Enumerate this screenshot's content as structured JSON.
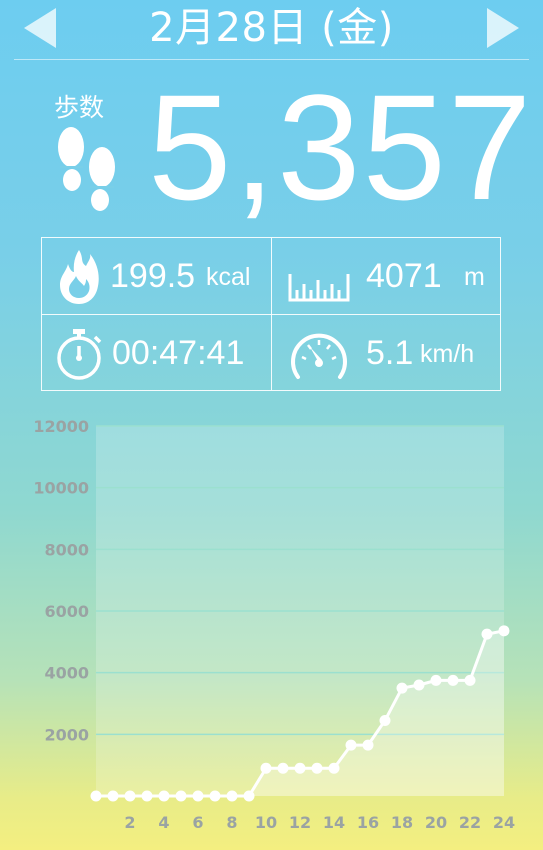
{
  "header": {
    "date": "2月28日 (金)",
    "prev_icon": "left-triangle-arrow",
    "next_icon": "right-triangle-arrow"
  },
  "steps": {
    "label": "歩数",
    "value": "5,357",
    "icon": "footprints-icon"
  },
  "stats": {
    "calories": {
      "value": "199.5",
      "unit": "kcal",
      "icon": "flame-icon"
    },
    "distance": {
      "value": "4071",
      "unit": "m",
      "icon": "ruler-icon"
    },
    "time": {
      "value": "00:47:41",
      "icon": "stopwatch-icon"
    },
    "speed": {
      "value": "5.1",
      "unit": "km/h",
      "icon": "speedometer-icon"
    }
  },
  "chart_data": {
    "type": "line",
    "title": "",
    "xlabel": "",
    "ylabel": "",
    "x": [
      0,
      1,
      2,
      3,
      4,
      5,
      6,
      7,
      8,
      9,
      10,
      11,
      12,
      13,
      14,
      15,
      16,
      17,
      18,
      19,
      20,
      21,
      22,
      23,
      24
    ],
    "x_tick_labels": [
      "2",
      "4",
      "6",
      "8",
      "10",
      "12",
      "14",
      "16",
      "18",
      "20",
      "22",
      "24"
    ],
    "y_tick_labels": [
      "2000",
      "4000",
      "6000",
      "8000",
      "10000",
      "12000"
    ],
    "ylim": [
      0,
      12000
    ],
    "xlim": [
      0,
      24
    ],
    "grid": true,
    "series": [
      {
        "values": [
          0,
          0,
          0,
          0,
          0,
          0,
          0,
          0,
          0,
          0,
          900,
          900,
          900,
          900,
          900,
          1650,
          1650,
          2450,
          3500,
          3600,
          3750,
          3750,
          3750,
          5250,
          5357
        ]
      }
    ],
    "colors": {
      "line": "#ffffff",
      "grid": "#9be0cf",
      "plot_bg": "rgba(255,255,255,0.2)",
      "tick_text": "#9aa3a3"
    }
  }
}
